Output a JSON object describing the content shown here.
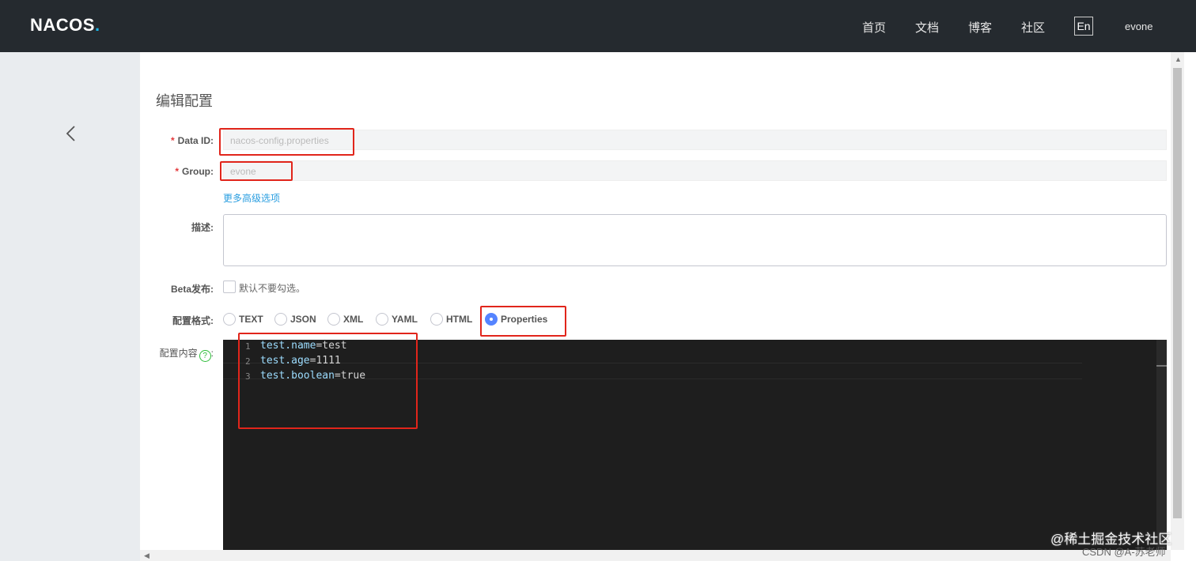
{
  "header": {
    "logo": "NACOS",
    "logo_dot": ".",
    "nav": [
      "首页",
      "文档",
      "博客",
      "社区"
    ],
    "language": "En",
    "user": "evone"
  },
  "page": {
    "title": "编辑配置"
  },
  "form": {
    "data_id_label": "Data ID:",
    "data_id_value": "nacos-config.properties",
    "group_label": "Group:",
    "group_value": "evone",
    "advanced_link": "更多高级选项",
    "description_label": "描述:",
    "beta_label": "Beta发布:",
    "beta_hint": "默认不要勾选。",
    "format_label": "配置格式:",
    "formats": [
      "TEXT",
      "JSON",
      "XML",
      "YAML",
      "HTML",
      "Properties"
    ],
    "selected_format": "Properties",
    "content_label": "配置内容",
    "content_help": "?",
    "content_suffix": ":"
  },
  "editor": {
    "lines": [
      {
        "num": "1",
        "key": "test.name",
        "value": "test"
      },
      {
        "num": "2",
        "key": "test.age",
        "value": "1111"
      },
      {
        "num": "3",
        "key": "test.boolean",
        "value": "true"
      }
    ]
  },
  "watermark": {
    "line1": "@稀土掘金技术社区",
    "line2": "CSDN @A-苏老师"
  }
}
